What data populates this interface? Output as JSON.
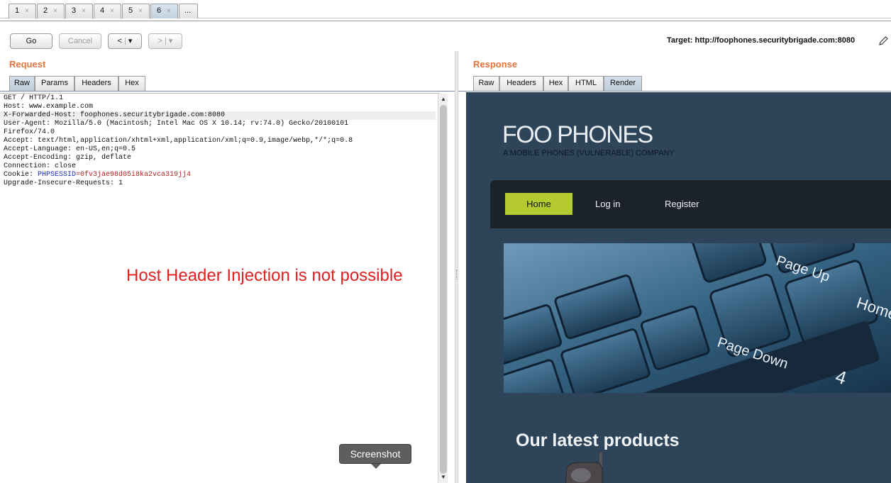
{
  "tabs": [
    {
      "label": "1"
    },
    {
      "label": "2"
    },
    {
      "label": "3"
    },
    {
      "label": "4"
    },
    {
      "label": "5"
    },
    {
      "label": "6"
    },
    {
      "label": "..."
    }
  ],
  "tab_close": "×",
  "toolbar": {
    "go": "Go",
    "cancel": "Cancel",
    "back": "<",
    "forward": ">",
    "dropdown": "▾",
    "target": "Target: http://foophones.securitybrigade.com:8080"
  },
  "request": {
    "title": "Request",
    "tabs": [
      "Raw",
      "Params",
      "Headers",
      "Hex"
    ],
    "lines": [
      "GET / HTTP/1.1",
      "Host: www.example.com",
      "X-Forwarded-Host: foophones.securitybrigade.com:8080",
      "User-Agent: Mozilla/5.0 (Macintosh; Intel Mac OS X 10.14; rv:74.0) Gecko/20100101",
      "Firefox/74.0",
      "Accept: text/html,application/xhtml+xml,application/xml;q=0.9,image/webp,*/*;q=0.8",
      "Accept-Language: en-US,en;q=0.5",
      "Accept-Encoding: gzip, deflate",
      "Connection: close"
    ],
    "cookie_prefix": "Cookie: ",
    "cookie_name": "PHPSESSID",
    "cookie_value": "=0fv3jae98d05i8ka2vca319jj4",
    "last_line": "Upgrade-Insecure-Requests: 1",
    "annotation": "Host Header Injection is not possible"
  },
  "tooltip": "Screenshot",
  "response": {
    "title": "Response",
    "tabs": [
      "Raw",
      "Headers",
      "Hex",
      "HTML",
      "Render"
    ],
    "site": {
      "title": "FOO PHONES",
      "subtitle": "A MOBILE PHONES (VULNERABLE) COMPANY",
      "nav": [
        "Home",
        "Log in",
        "Register"
      ],
      "keys": [
        "Page Up",
        "Page Down",
        "Home",
        "4"
      ],
      "section": "Our latest products"
    }
  },
  "colors": {
    "accent": "#e8733a",
    "annotation": "#e32020",
    "site_bg": "#2e4458",
    "nav_active": "#b4ca2e"
  }
}
